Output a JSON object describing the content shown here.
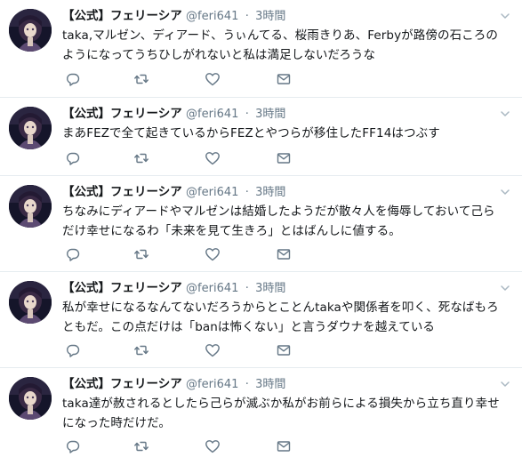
{
  "account": {
    "display_name": "【公式】フェリーシア",
    "handle": "@feri641",
    "separator": "·"
  },
  "icons": {
    "reply": "reply-icon",
    "retweet": "retweet-icon",
    "like": "heart-icon",
    "dm": "envelope-icon",
    "menu": "chevron-down-icon"
  },
  "colors": {
    "text": "#14171a",
    "secondary": "#657786",
    "divider": "#e6ecf0"
  },
  "tweets": [
    {
      "time": "3時間",
      "text": "taka,マルゼン、ディアード、うぃんてる、桜雨きりあ、Ferbyが路傍の石ころの\nようになってうちひしがれないと私は満足しないだろうな"
    },
    {
      "time": "3時間",
      "text": "まあFEZで全て起きているからFEZとやつらが移住したFF14はつぶす"
    },
    {
      "time": "3時間",
      "text": "ちなみにディアードやマルゼンは結婚したようだが散々人を侮辱しておいて己ら\nだけ幸せになるわ「未来を見て生きろ」とはばんしに値する。"
    },
    {
      "time": "3時間",
      "text": "私が幸せになるなんてないだろうからとことんtakaや関係者を叩く、死なばもろ\nともだ。この点だけは「banは怖くない」と言うダウナを越えている"
    },
    {
      "time": "3時間",
      "text": "taka達が赦されるとしたら己らが滅ぶか私がお前らによる損失から立ち直り幸せ\nになった時だけだ。"
    }
  ]
}
